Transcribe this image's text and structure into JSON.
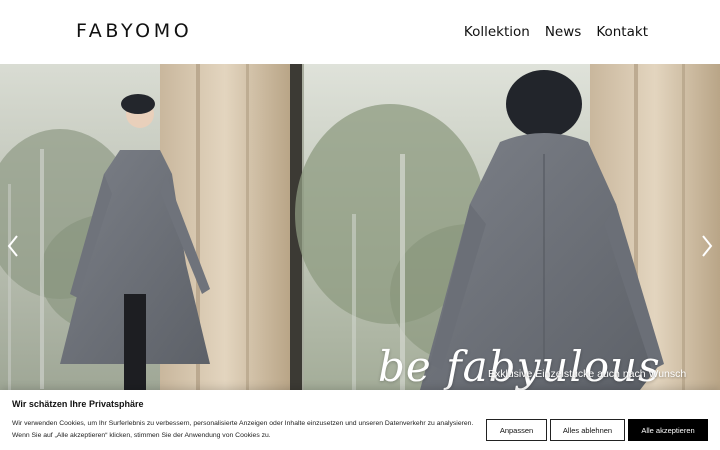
{
  "header": {
    "logo": "FABYOMO",
    "nav": [
      "Kollektion",
      "News",
      "Kontakt"
    ]
  },
  "hero": {
    "tagline": "be fabyulous",
    "subline": "Exklusive Einzelstücke auch nach Wunsch",
    "icons": {
      "prev": "chevron-left-icon",
      "next": "chevron-right-icon"
    }
  },
  "cookie": {
    "title": "Wir schätzen Ihre Privatsphäre",
    "text": "Wir verwenden Cookies, um Ihr Surferlebnis zu verbessern, personalisierte Anzeigen oder Inhalte einzusetzen und unseren Datenverkehr zu analysieren. Wenn Sie auf „Alle akzeptieren“ klicken, stimmen Sie der Anwendung von Cookies zu.",
    "buttons": {
      "customize": "Anpassen",
      "reject": "Alles ablehnen",
      "accept": "Alle akzeptieren"
    }
  },
  "colors": {
    "accept_bg": "#000000",
    "text": "#111111"
  }
}
